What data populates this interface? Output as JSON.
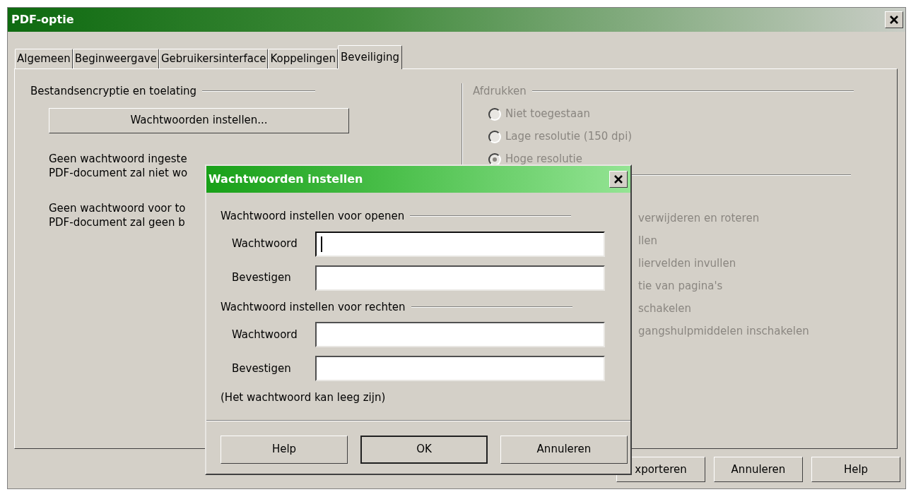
{
  "window": {
    "title": "PDF-optie",
    "tabs": [
      {
        "label": "Algemeen",
        "selected": false
      },
      {
        "label": "Beginweergave",
        "selected": false
      },
      {
        "label": "Gebruikersinterface",
        "selected": false
      },
      {
        "label": "Koppelingen",
        "selected": false
      },
      {
        "label": "Beveiliging",
        "selected": true
      }
    ],
    "encryption": {
      "heading": "Bestandsencryptie en toelating",
      "button": "Wachtwoorden instellen...",
      "notes": [
        [
          "Geen wachtwoord ingeste",
          "PDF-document zal niet wo"
        ],
        [
          "Geen wachtwoord voor to",
          "PDF-document zal geen b"
        ]
      ]
    },
    "printing": {
      "heading": "Afdrukken",
      "disabled": true,
      "options": [
        {
          "label": "Niet toegestaan",
          "selected": false
        },
        {
          "label": "Lage resolutie (150 dpi)",
          "selected": false
        },
        {
          "label": "Hoge resolutie",
          "selected": true
        }
      ]
    },
    "changes": {
      "disabled": true,
      "items": [
        "verwijderen en roteren",
        "llen",
        "liervelden invullen",
        "tie van pagina's",
        "schakelen",
        "gangshulpmiddelen inschakelen"
      ]
    },
    "buttons": [
      "xporteren",
      "Annuleren",
      "Help"
    ]
  },
  "dialog": {
    "title": "Wachtwoorden instellen",
    "sections": [
      {
        "heading": "Wachtwoord instellen voor openen",
        "fields": [
          {
            "label": "Wachtwoord",
            "focused": true
          },
          {
            "label": "Bevestigen",
            "focused": false
          }
        ]
      },
      {
        "heading": "Wachtwoord instellen voor rechten",
        "fields": [
          {
            "label": "Wachtwoord",
            "focused": false
          },
          {
            "label": "Bevestigen",
            "focused": false
          }
        ]
      }
    ],
    "note": "(Het wachtwoord kan leeg zijn)",
    "buttons": [
      {
        "label": "Help",
        "default": false
      },
      {
        "label": "OK",
        "default": true
      },
      {
        "label": "Annuleren",
        "default": false
      }
    ]
  }
}
